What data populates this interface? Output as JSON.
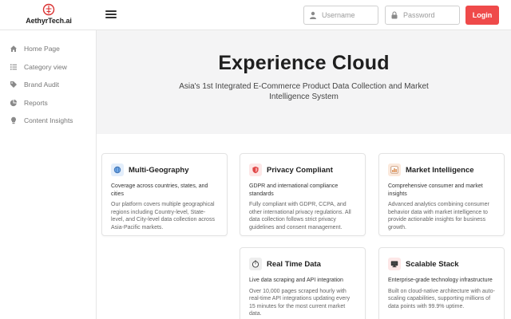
{
  "brand": {
    "name": "AethyrTech.ai"
  },
  "header": {
    "username_placeholder": "Username",
    "password_placeholder": "Password",
    "login_label": "Login"
  },
  "sidebar": {
    "items": [
      {
        "label": "Home Page",
        "icon": "home-icon"
      },
      {
        "label": "Category view",
        "icon": "list-icon"
      },
      {
        "label": "Brand Audit",
        "icon": "tag-icon"
      },
      {
        "label": "Reports",
        "icon": "pie-chart-icon"
      },
      {
        "label": "Content Insights",
        "icon": "lightbulb-icon"
      }
    ]
  },
  "hero": {
    "title": "Experience Cloud",
    "subtitle": "Asia's 1st Integrated E-Commerce Product Data Collection and Market Intelligence System"
  },
  "cards": [
    {
      "title": "Multi-Geography",
      "icon": "globe-icon",
      "lead": "Coverage across countries, states, and cities",
      "body": "Our platform covers multiple geographical regions including Country-level, State-level, and City-level data collection across Asia-Pacific markets."
    },
    {
      "title": "Privacy Compliant",
      "icon": "shield-icon",
      "lead": "GDPR and international compliance standards",
      "body": "Fully compliant with GDPR, CCPA, and other international privacy regulations. All data collection follows strict privacy guidelines and consent management."
    },
    {
      "title": "Market Intelligence",
      "icon": "bar-chart-icon",
      "lead": "Comprehensive consumer and market insights",
      "body": "Advanced analytics combining consumer behavior data with market intelligence to provide actionable insights for business growth."
    },
    {
      "title": "Real Time Data",
      "icon": "timer-icon",
      "lead": "Live data scraping and API integration",
      "body": "Over 10,000 pages scraped hourly with real-time API integrations updating every 15 minutes for the most current market data."
    },
    {
      "title": "Scalable Stack",
      "icon": "monitor-icon",
      "lead": "Enterprise-grade technology infrastructure",
      "body": "Built on cloud-native architecture with auto-scaling capabilities, supporting millions of data points with 99.9% uptime."
    }
  ],
  "colors": {
    "accent": "#ef4a4a",
    "hero_bg": "#f4f4f5",
    "globe_bg": "#e3eefb",
    "shield_bg": "#fde7e7",
    "chart_bg": "#fbe9dc",
    "timer_bg": "#eeeeee",
    "monitor_bg": "#fde7e7"
  }
}
